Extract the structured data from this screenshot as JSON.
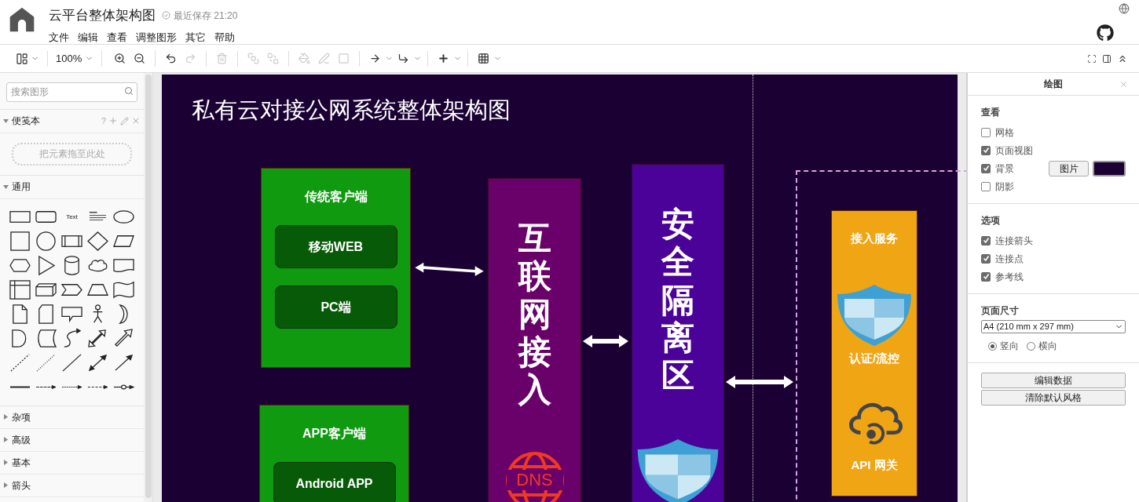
{
  "header": {
    "title": "云平台整体架构图",
    "save_status": "最近保存 21:20",
    "menus": [
      "文件",
      "编辑",
      "查看",
      "调整图形",
      "其它",
      "帮助"
    ]
  },
  "toolbar": {
    "zoom": "100%",
    "tools": [
      {
        "kind": "zoom-in",
        "disabled": false
      },
      {
        "kind": "zoom-out",
        "disabled": false
      },
      {
        "kind": "undo",
        "disabled": false
      },
      {
        "kind": "redo",
        "disabled": true
      },
      {
        "kind": "delete",
        "disabled": true
      },
      {
        "kind": "to-front",
        "disabled": true
      },
      {
        "kind": "to-back",
        "disabled": true
      },
      {
        "kind": "fill",
        "disabled": true
      },
      {
        "kind": "line",
        "disabled": true
      },
      {
        "kind": "shadow",
        "disabled": true
      },
      {
        "kind": "connection",
        "disabled": false
      },
      {
        "kind": "waypoint",
        "disabled": false
      },
      {
        "kind": "insert",
        "disabled": false
      },
      {
        "kind": "table",
        "disabled": false
      }
    ]
  },
  "sidebar": {
    "search": {
      "placeholder": "搜索图形"
    },
    "scratchpad": {
      "label": "便笺本",
      "expanded": true,
      "help": "?",
      "dropzone": "把元素拖至此处"
    },
    "general": {
      "label": "通用",
      "expanded": true,
      "text_shape": "Text"
    },
    "sections": [
      {
        "label": "杂项",
        "expanded": false
      },
      {
        "label": "高级",
        "expanded": false
      },
      {
        "label": "基本",
        "expanded": false
      },
      {
        "label": "箭头",
        "expanded": false
      }
    ]
  },
  "diagram": {
    "title": "私有云对接公网系统整体架构图",
    "client_groups": [
      {
        "title": "传统客户端",
        "items": [
          "移动WEB",
          "PC端"
        ]
      },
      {
        "title": "APP客户端",
        "items": [
          "Android APP"
        ]
      }
    ],
    "internet_column": {
      "text": "互联网接入",
      "icon_label": "DNS"
    },
    "security_column": {
      "text": "安全隔离区"
    },
    "service_box": {
      "title": "接入服务",
      "items": [
        "认证/流控",
        "API 网关"
      ]
    }
  },
  "format_panel": {
    "title": "绘图",
    "view": {
      "heading": "查看",
      "options": [
        {
          "label": "网格",
          "checked": false
        },
        {
          "label": "页面视图",
          "checked": true
        },
        {
          "label": "背景",
          "checked": true
        },
        {
          "label": "阴影",
          "checked": false
        }
      ],
      "image_button": "图片",
      "background_swatch": {
        "color": "#1b0033"
      }
    },
    "options": {
      "heading": "选项",
      "options": [
        {
          "label": "连接箭头",
          "checked": true
        },
        {
          "label": "连接点",
          "checked": true
        },
        {
          "label": "参考线",
          "checked": true
        }
      ]
    },
    "page_size": {
      "heading": "页面尺寸",
      "value": "A4 (210 mm x 297 mm)",
      "orientations": [
        {
          "label": "竖向",
          "selected": true
        },
        {
          "label": "横向",
          "selected": false
        }
      ]
    },
    "buttons": [
      "编辑数据",
      "清除默认风格"
    ]
  }
}
